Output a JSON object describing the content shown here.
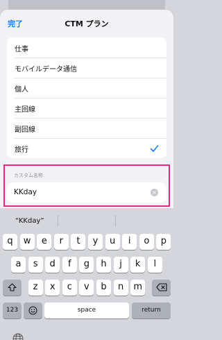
{
  "navbar": {
    "done_label": "完了",
    "title": "CTM プラン"
  },
  "plan_options": [
    {
      "label": "仕事",
      "selected": false
    },
    {
      "label": "モバイルデータ通信",
      "selected": false
    },
    {
      "label": "個人",
      "selected": false
    },
    {
      "label": "主回線",
      "selected": false
    },
    {
      "label": "副回線",
      "selected": false
    },
    {
      "label": "旅行",
      "selected": true
    }
  ],
  "custom_name": {
    "label": "カスタム名称",
    "value": "KKday"
  },
  "keyboard": {
    "suggestion": "“KKday”",
    "row1": [
      "q",
      "w",
      "e",
      "r",
      "t",
      "y",
      "u",
      "i",
      "o",
      "p"
    ],
    "row2": [
      "a",
      "s",
      "d",
      "f",
      "g",
      "h",
      "j",
      "k",
      "l"
    ],
    "row3": [
      "z",
      "x",
      "c",
      "v",
      "b",
      "n",
      "m"
    ],
    "numbers_label": "123",
    "space_label": "space",
    "return_label": "return"
  },
  "colors": {
    "accent": "#1a7cf5",
    "highlight": "#e5297a"
  }
}
